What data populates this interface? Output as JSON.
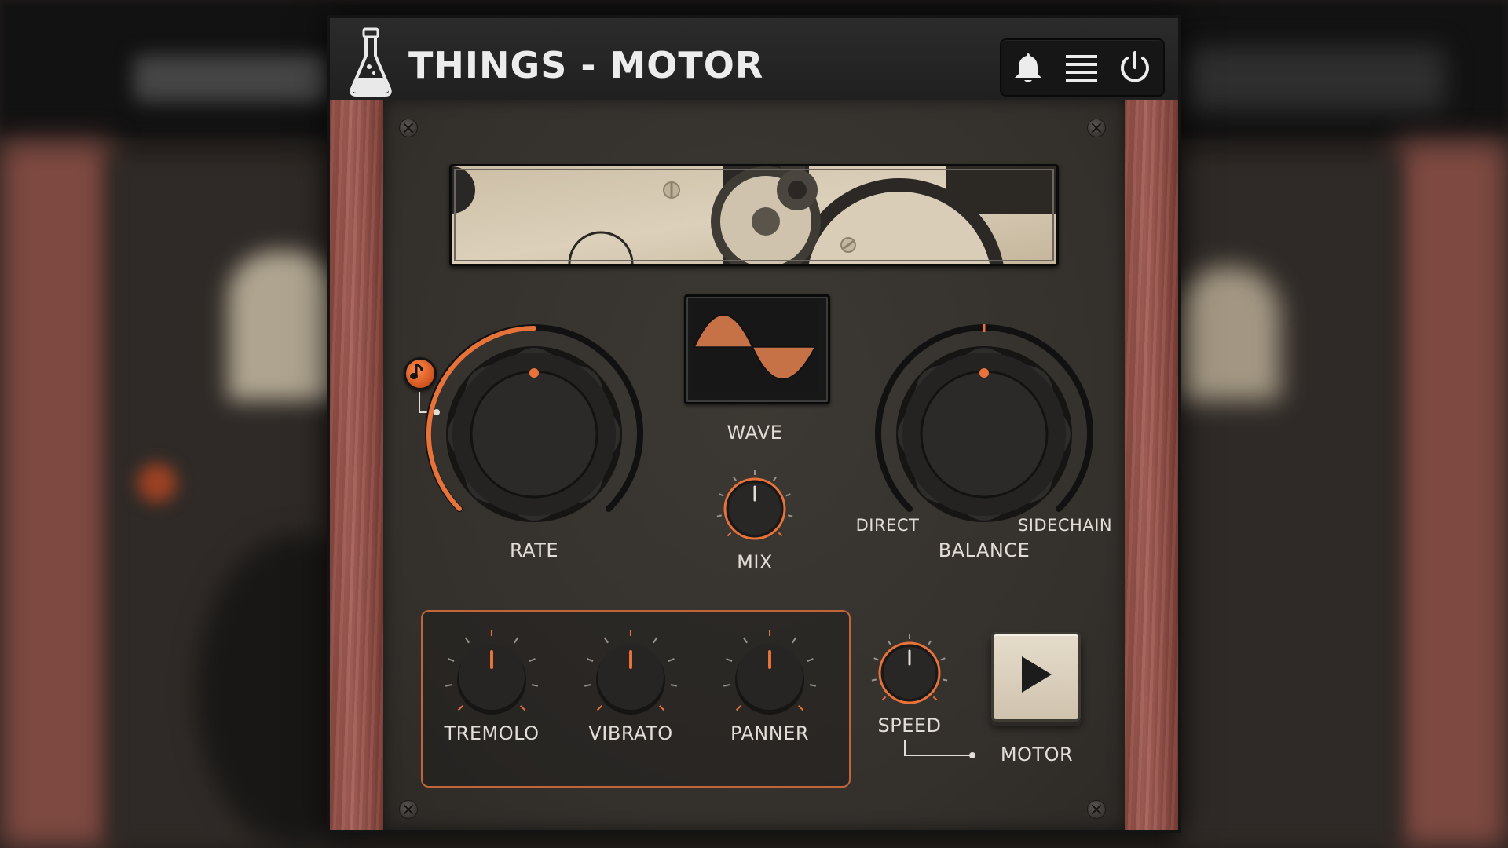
{
  "app": {
    "title": "THINGS - MOTOR"
  },
  "toolbar": {
    "icons": [
      "bell-icon",
      "menu-icon",
      "power-icon"
    ]
  },
  "controls": {
    "rate": {
      "label": "RATE",
      "value_fraction": 0.5
    },
    "wave": {
      "label": "WAVE",
      "shape": "sine"
    },
    "mix": {
      "label": "MIX",
      "value_fraction": 0.5
    },
    "balance": {
      "label": "BALANCE",
      "left_label": "DIRECT",
      "right_label": "SIDECHAIN",
      "value_fraction": 0.5
    },
    "tremolo": {
      "label": "TREMOLO",
      "value_fraction": 0.5
    },
    "vibrato": {
      "label": "VIBRATO",
      "value_fraction": 0.5
    },
    "panner": {
      "label": "PANNER",
      "value_fraction": 0.5
    },
    "speed": {
      "label": "SPEED",
      "value_fraction": 0.5
    },
    "motor": {
      "label": "MOTOR",
      "icon": "play-icon"
    },
    "sync": {
      "icon": "music-note-icon"
    }
  },
  "colors": {
    "accent": "#e8733a",
    "text": "#e2ddd6",
    "panel": "#36322e",
    "wood": "#a05c52",
    "cream": "#ddd2bf"
  }
}
